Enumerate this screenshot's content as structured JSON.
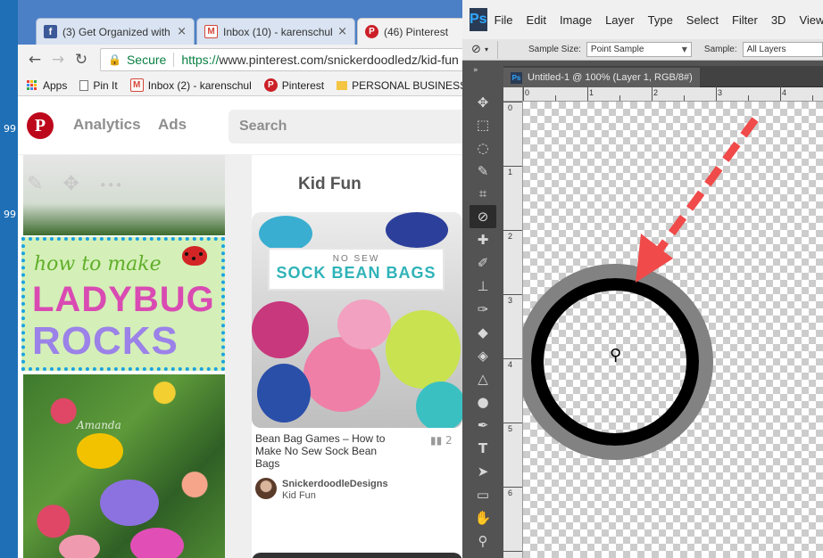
{
  "desktop": {
    "glyphs": [
      "99",
      "99"
    ]
  },
  "chrome": {
    "tabs": [
      {
        "favicon": "facebook-icon",
        "title": "(3) Get Organized with",
        "close": "×"
      },
      {
        "favicon": "gmail-icon",
        "title": "Inbox (10) - karenschul",
        "close": "×"
      },
      {
        "favicon": "pinterest-icon",
        "title": "(46) Pinterest",
        "close": "×"
      }
    ],
    "omnibox": {
      "secure_label": "Secure",
      "url_scheme": "https://",
      "url_rest": "www.pinterest.com/snickerdoodledz/kid-fun"
    },
    "bookmarks": [
      {
        "icon": "apps-icon",
        "label": "Apps"
      },
      {
        "icon": "page-icon",
        "label": "Pin It"
      },
      {
        "icon": "gmail-icon",
        "label": "Inbox (2) - karenschul"
      },
      {
        "icon": "pinterest-icon",
        "label": "Pinterest"
      },
      {
        "icon": "folder-icon",
        "label": "PERSONAL BUSINESS"
      }
    ]
  },
  "pinterest": {
    "logo": "P",
    "nav": {
      "analytics": "Analytics",
      "ads": "Ads"
    },
    "search_placeholder": "Search",
    "pin_actions": {
      "edit": "✎",
      "move": "✥",
      "more": "•••"
    },
    "ladybug_pin": {
      "line1": "how to make",
      "line2": "LADYBUG",
      "line3": "ROCKS",
      "watermark": "Amanda"
    },
    "board_title": "Kid Fun",
    "sock_pin": {
      "banner_small": "NO SEW",
      "banner_big": "SOCK BEAN BAGS",
      "description": "Bean Bag Games – How to Make No Sew Sock Bean Bags",
      "stat": "2",
      "user": "SnickerdoodleDesigns",
      "board": "Kid Fun"
    }
  },
  "photoshop": {
    "logo": "Ps",
    "menu": [
      "File",
      "Edit",
      "Image",
      "Layer",
      "Type",
      "Select",
      "Filter",
      "3D",
      "View"
    ],
    "options": {
      "sample_size_label": "Sample Size:",
      "sample_size_value": "Point Sample",
      "sample_label": "Sample:",
      "sample_value": "All Layers"
    },
    "document_tab": "Untitled-1 @ 100% (Layer 1, RGB/8#)",
    "ruler_top_numbers": [
      "0",
      "1",
      "2",
      "3",
      "4"
    ],
    "ruler_left_numbers": [
      "0",
      "1",
      "2",
      "3",
      "4",
      "5",
      "6"
    ],
    "tools": [
      "move-tool-icon",
      "marquee-tool-icon",
      "lasso-tool-icon",
      "quick-select-tool-icon",
      "crop-tool-icon",
      "eyedropper-tool-icon",
      "healing-brush-tool-icon",
      "brush-tool-icon",
      "clone-stamp-tool-icon",
      "history-brush-tool-icon",
      "eraser-tool-icon",
      "paint-bucket-tool-icon",
      "blur-tool-icon",
      "dodge-tool-icon",
      "pen-tool-icon",
      "type-tool-icon",
      "path-select-tool-icon",
      "shape-tool-icon",
      "hand-tool-icon",
      "zoom-tool-icon"
    ],
    "active_tool": "eyedropper-tool-icon",
    "colors": {
      "ring_outer": "#828282",
      "ring_inner": "#000000",
      "arrow": "#f04a4a"
    }
  }
}
